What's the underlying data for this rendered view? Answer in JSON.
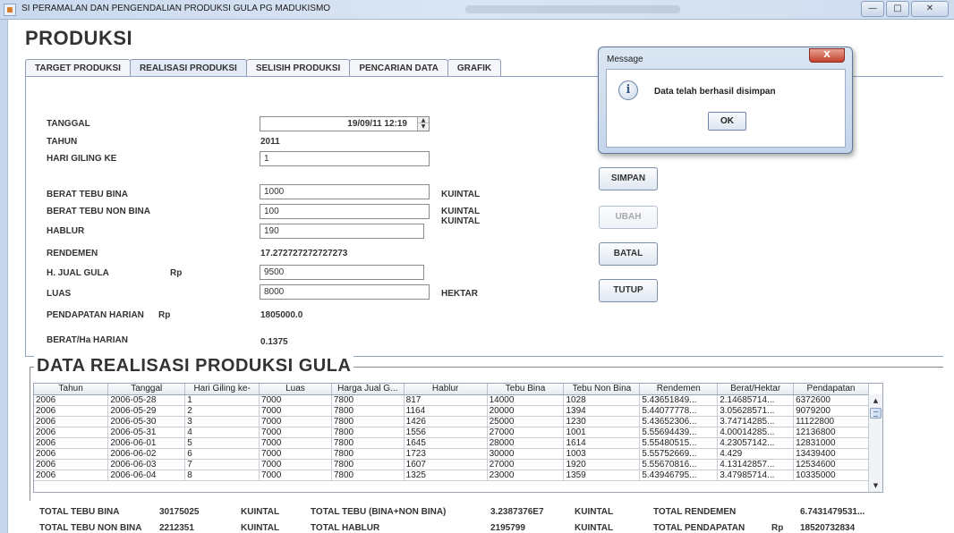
{
  "window": {
    "title": "SI PERAMALAN DAN PENGENDALIAN PRODUKSI GULA PG MADUKISMO",
    "btn_min": "—",
    "btn_max": "□",
    "btn_close": "✕"
  },
  "page_title": "PRODUKSI",
  "tabs": [
    {
      "label": "TARGET PRODUKSI"
    },
    {
      "label": "REALISASI PRODUKSI"
    },
    {
      "label": "SELISIH PRODUKSI"
    },
    {
      "label": "PENCARIAN DATA"
    },
    {
      "label": "GRAFIK"
    }
  ],
  "form": {
    "tanggal_label": "TANGGAL",
    "tanggal_value": "19/09/11 12:19",
    "tahun_label": "TAHUN",
    "tahun_value": "2011",
    "hari_label": "HARI GILING KE",
    "hari_value": "1",
    "bina_label": "BERAT TEBU BINA",
    "bina_value": "1000",
    "bina_unit": "KUINTAL",
    "nonbina_label": "BERAT TEBU NON BINA",
    "nonbina_value": "100",
    "nonbina_unit": "KUINTAL",
    "hablur_label": "HABLUR",
    "hablur_value": "190",
    "hablur_unit": "KUINTAL",
    "rendemen_label": "RENDEMEN",
    "rendemen_value": "17.272727272727273",
    "hjual_label": "H. JUAL GULA",
    "hjual_rp": "Rp",
    "hjual_value": "9500",
    "luas_label": "LUAS",
    "luas_value": "8000",
    "luas_unit": "HEKTAR",
    "pendapatan_label": "PENDAPATAN HARIAN",
    "pendapatan_rp": "Rp",
    "pendapatan_value": "1805000.0",
    "beratha_label": "BERAT/Ha HARIAN",
    "beratha_value": "0.1375"
  },
  "buttons": {
    "simpan": "SIMPAN",
    "ubah": "UBAH",
    "batal": "BATAL",
    "tutup": "TUTUP"
  },
  "dialog": {
    "title": "Message",
    "close": "X",
    "icon": "i",
    "message": "Data telah berhasil disimpan",
    "ok": "OK"
  },
  "section_title": "DATA REALISASI PRODUKSI GULA",
  "table": {
    "headers": [
      "Tahun",
      "Tanggal",
      "Hari Giling ke-",
      "Luas",
      "Harga Jual G...",
      "Hablur",
      "Tebu Bina",
      "Tebu Non Bina",
      "Rendemen",
      "Berat/Hektar",
      "Pendapatan"
    ],
    "rows": [
      [
        "2006",
        "2006-05-28",
        "1",
        "7000",
        "7800",
        "817",
        "14000",
        "1028",
        "5.43651849...",
        "2.14685714...",
        "6372600"
      ],
      [
        "2006",
        "2006-05-29",
        "2",
        "7000",
        "7800",
        "1164",
        "20000",
        "1394",
        "5.44077778...",
        "3.05628571...",
        "9079200"
      ],
      [
        "2006",
        "2006-05-30",
        "3",
        "7000",
        "7800",
        "1426",
        "25000",
        "1230",
        "5.43652306...",
        "3.74714285...",
        "11122800"
      ],
      [
        "2006",
        "2006-05-31",
        "4",
        "7000",
        "7800",
        "1556",
        "27000",
        "1001",
        "5.55694439...",
        "4.00014285...",
        "12136800"
      ],
      [
        "2006",
        "2006-06-01",
        "5",
        "7000",
        "7800",
        "1645",
        "28000",
        "1614",
        "5.55480515...",
        "4.23057142...",
        "12831000"
      ],
      [
        "2006",
        "2006-06-02",
        "6",
        "7000",
        "7800",
        "1723",
        "30000",
        "1003",
        "5.55752669...",
        "4.429",
        "13439400"
      ],
      [
        "2006",
        "2006-06-03",
        "7",
        "7000",
        "7800",
        "1607",
        "27000",
        "1920",
        "5.55670816...",
        "4.13142857...",
        "12534600"
      ],
      [
        "2006",
        "2006-06-04",
        "8",
        "7000",
        "7800",
        "1325",
        "23000",
        "1359",
        "5.43946795...",
        "3.47985714...",
        "10335000"
      ]
    ],
    "scroll_up": "▲",
    "scroll_down": "▼"
  },
  "totals": {
    "tebu_bina_label": "TOTAL TEBU BINA",
    "tebu_bina_value": "30175025",
    "tebu_bina_unit": "KUINTAL",
    "tebu_total_label": "TOTAL TEBU (BINA+NON BINA)",
    "tebu_total_value": "3.2387376E7",
    "tebu_total_unit": "KUINTAL",
    "rendemen_label": "TOTAL RENDEMEN",
    "rendemen_value": "6.7431479531...",
    "tebu_nonbina_label": "TOTAL TEBU NON BINA",
    "tebu_nonbina_value": "2212351",
    "tebu_nonbina_unit": "KUINTAL",
    "hablur_label": "TOTAL HABLUR",
    "hablur_value": "2195799",
    "hablur_unit": "KUINTAL",
    "pendapatan_label": "TOTAL PENDAPATAN",
    "pendapatan_rp": "Rp",
    "pendapatan_value": "18520732834"
  }
}
